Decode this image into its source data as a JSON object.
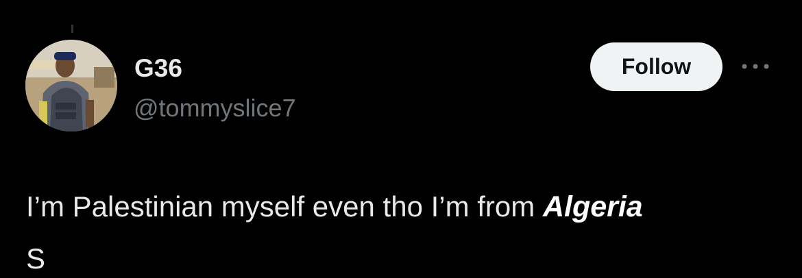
{
  "post": {
    "author": {
      "display_name": "G36",
      "handle": "@tommyslice7"
    },
    "follow_label": "Follow",
    "more_icon": "ellipsis-icon",
    "text_main": "I’m Palestinian myself even tho I’m from ",
    "text_highlight": "Algeria",
    "text_cut": "S     "
  },
  "colors": {
    "background": "#000000",
    "primary_text": "#e7e9ea",
    "secondary_text": "#71767b",
    "follow_bg": "#eff3f4",
    "follow_text": "#0f1419"
  }
}
